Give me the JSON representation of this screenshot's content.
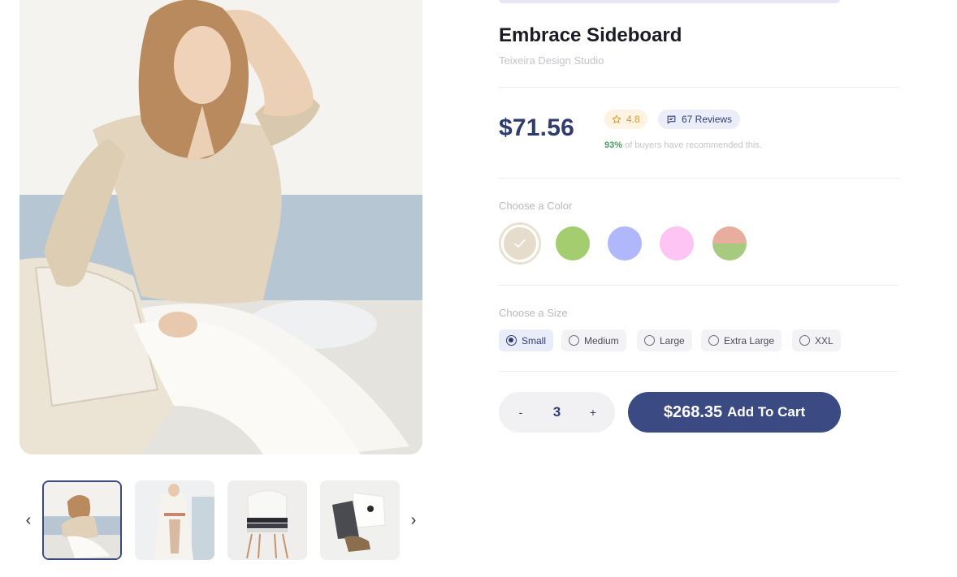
{
  "product": {
    "title": "Embrace Sideboard",
    "brand": "Teixeira Design Studio",
    "price": "$71.56",
    "rating": "4.8",
    "reviews": "67 Reviews",
    "recommend_pct": "93%",
    "recommend_text": " of buyers have recommended this."
  },
  "colors": {
    "label": "Choose a Color",
    "options": [
      "#e6dccb",
      "#a3cd6e",
      "#b0b8fb",
      "#fdc4f4",
      "#e7ae9d/#a8c980"
    ],
    "selected_index": 0
  },
  "sizes": {
    "label": "Choose a Size",
    "options": [
      "Small",
      "Medium",
      "Large",
      "Extra Large",
      "XXL"
    ],
    "selected": "Small"
  },
  "cart": {
    "decrement": "-",
    "quantity": "3",
    "increment": "+",
    "total": "$268.35",
    "label": "Add To Cart"
  },
  "gallery": {
    "prev": "‹",
    "next": "›",
    "thumbnails": [
      "woman-beige-blouse",
      "woman-white-coat",
      "folded-clothes-on-chair",
      "flatlay-outfit"
    ],
    "active_index": 0
  },
  "theme": {
    "accent": "#3b4a83",
    "rating_color": "#d99a2b",
    "recommend_color": "#4c9b5e"
  }
}
